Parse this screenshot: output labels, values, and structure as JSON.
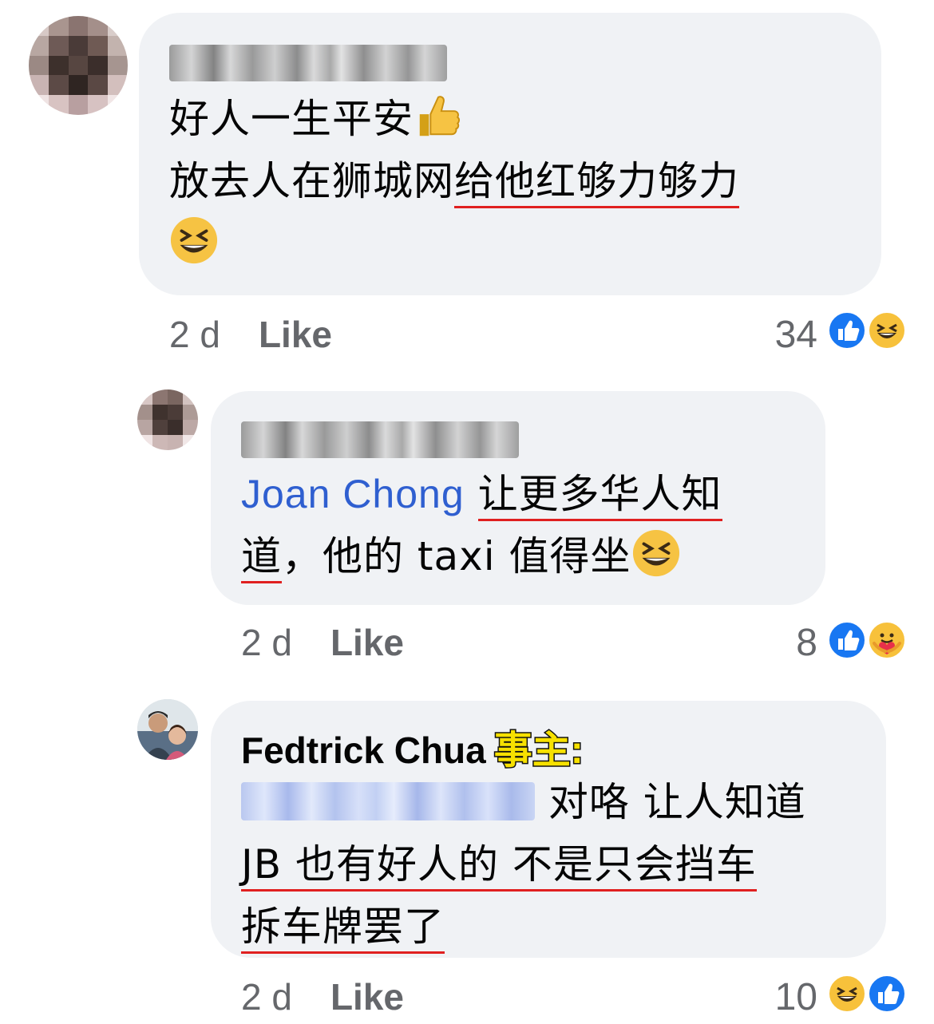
{
  "comments": [
    {
      "author_blurred": "Gladys Chong",
      "lines": [
        "好人一生平安",
        "放去人在狮城网",
        "给他红够力够力"
      ],
      "time": "2 d",
      "like_label": "Like",
      "reaction_count": "34",
      "reactions": [
        "like-icon",
        "haha-icon"
      ]
    },
    {
      "author_blurred": "Gladys Chong",
      "mention": "Joan Chong",
      "lines": [
        "让更多华人知",
        "道",
        "，他的 taxi 值得坐"
      ],
      "time": "2 d",
      "like_label": "Like",
      "reaction_count": "8",
      "reactions": [
        "like-icon",
        "care-icon"
      ]
    },
    {
      "author": "Fedtrick Chua",
      "tag": "事主:",
      "mention_blurred": "Gladys Chong",
      "lines": [
        "对咯 让人知道",
        "JB 也有好人的 不是只会挡车",
        "拆车牌罢了"
      ],
      "time": "2 d",
      "like_label": "Like",
      "reaction_count": "10",
      "reactions": [
        "haha-icon",
        "like-icon"
      ]
    }
  ],
  "colors": {
    "bubble": "#f0f2f5",
    "mention": "#2f5fd0",
    "meta": "#65676b",
    "underline": "#e02020",
    "tag_fill": "#f7e100"
  }
}
